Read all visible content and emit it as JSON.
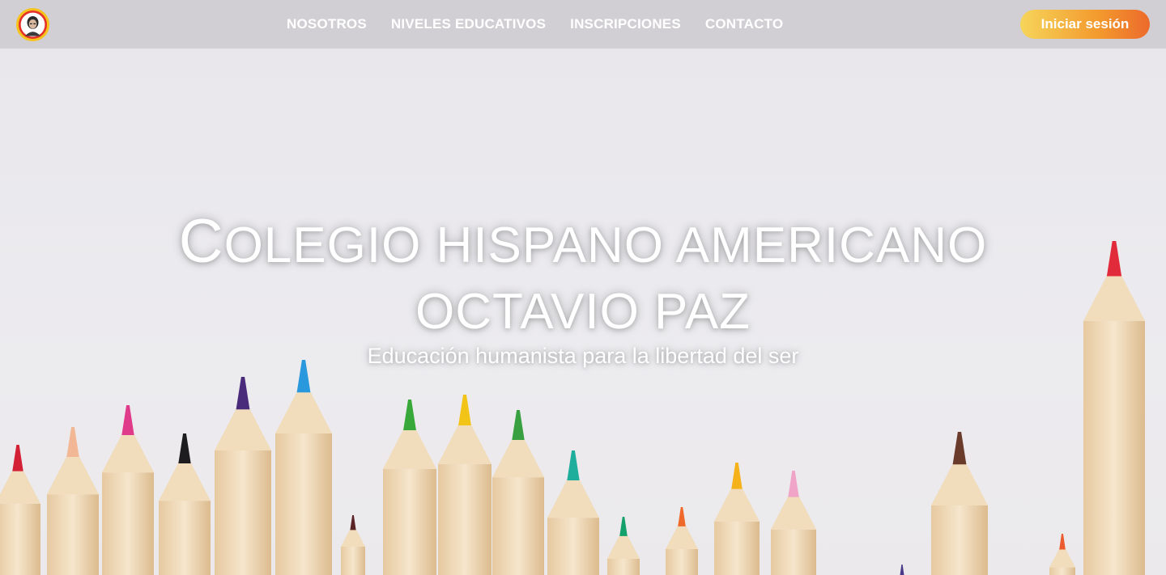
{
  "header": {
    "logo_icon": "school-crest-icon",
    "nav": [
      {
        "label": "NOSOTROS"
      },
      {
        "label": "NIVELES EDUCATIVOS"
      },
      {
        "label": "INSCRIPCIONES"
      },
      {
        "label": "CONTACTO"
      }
    ],
    "login_label": "Iniciar sesión"
  },
  "hero": {
    "title_first_letter": "C",
    "title_line1_rest": "OLEGIO HISPANO AMERICANO",
    "title_line2": "OCTAVIO PAZ",
    "subtitle": "Educación humanista para la libertad del ser",
    "background_icon": "colored-pencils-image"
  },
  "colors": {
    "header_bg": "#d1cfd3",
    "button_gradient_start": "#f6d55a",
    "button_gradient_end": "#ec6a2b",
    "hero_bg": "#e9e7eb"
  }
}
